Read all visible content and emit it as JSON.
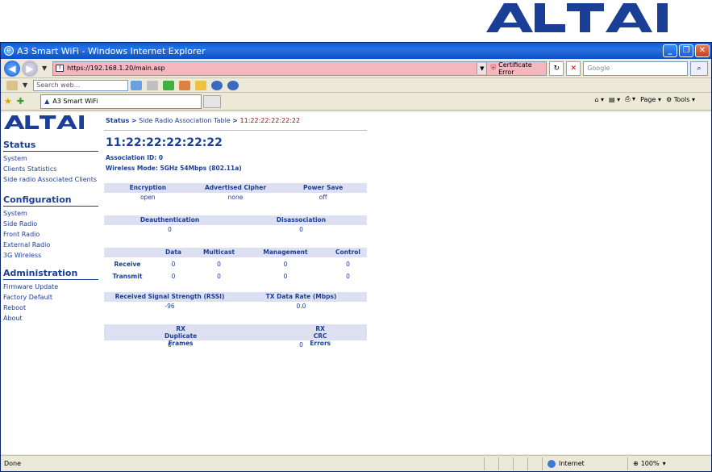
{
  "brand": {
    "name": "ALTAI",
    "color": "#1b3e96"
  },
  "browser": {
    "title": "A3 Smart WiFi - Windows Internet Explorer",
    "url": "https://192.168.1.20/main.asp",
    "cert_error": "Certificate Error",
    "google_placeholder": "Google",
    "search_web_placeholder": "Search web...",
    "tab_label": "A3 Smart WiFi",
    "page_menu": "Page",
    "tools_menu": "Tools",
    "status_done": "Done",
    "zone": "Internet",
    "zoom": "100%"
  },
  "nav": {
    "status": {
      "heading": "Status",
      "links": [
        "System",
        "Clients Statistics",
        "Side radio Associated Clients"
      ]
    },
    "configuration": {
      "heading": "Configuration",
      "links": [
        "System",
        "Side Radio",
        "Front Radio",
        "External Radio",
        "3G Wireless"
      ]
    },
    "administration": {
      "heading": "Administration",
      "links": [
        "Firmware Update",
        "Factory Default",
        "Reboot",
        "About"
      ]
    }
  },
  "main": {
    "breadcrumb": {
      "status": "Status",
      "sep": ">",
      "table": "Side Radio Association Table",
      "mac": "11:22:22:22:22:22"
    },
    "title": "11:22:22:22:22:22",
    "association_id": "Association ID: 0",
    "wireless_mode": "Wireless Mode: 5GHz 54Mbps (802.11a)",
    "security": {
      "headers": [
        "Encryption",
        "Advertised Cipher",
        "Power Save"
      ],
      "values": [
        "open",
        "none",
        "off"
      ]
    },
    "deauth": {
      "headers": [
        "Deauthentication",
        "Disassociation"
      ],
      "values": [
        "0",
        "0"
      ]
    },
    "frames": {
      "headers": [
        "",
        "Data",
        "Multicast",
        "Management",
        "Control"
      ],
      "rows": [
        {
          "label": "Receive",
          "values": [
            "0",
            "0",
            "0",
            "0"
          ]
        },
        {
          "label": "Transmit",
          "values": [
            "0",
            "0",
            "0",
            "0"
          ]
        }
      ]
    },
    "signal": {
      "headers": [
        "Received Signal Strength (RSSI)",
        "TX Data Rate (Mbps)"
      ],
      "values": [
        "-96",
        "0.0"
      ]
    },
    "dups": {
      "headers": [
        "RX Duplicate Frames",
        "RX CRC Errors"
      ],
      "values": [
        "0",
        "0"
      ]
    }
  }
}
